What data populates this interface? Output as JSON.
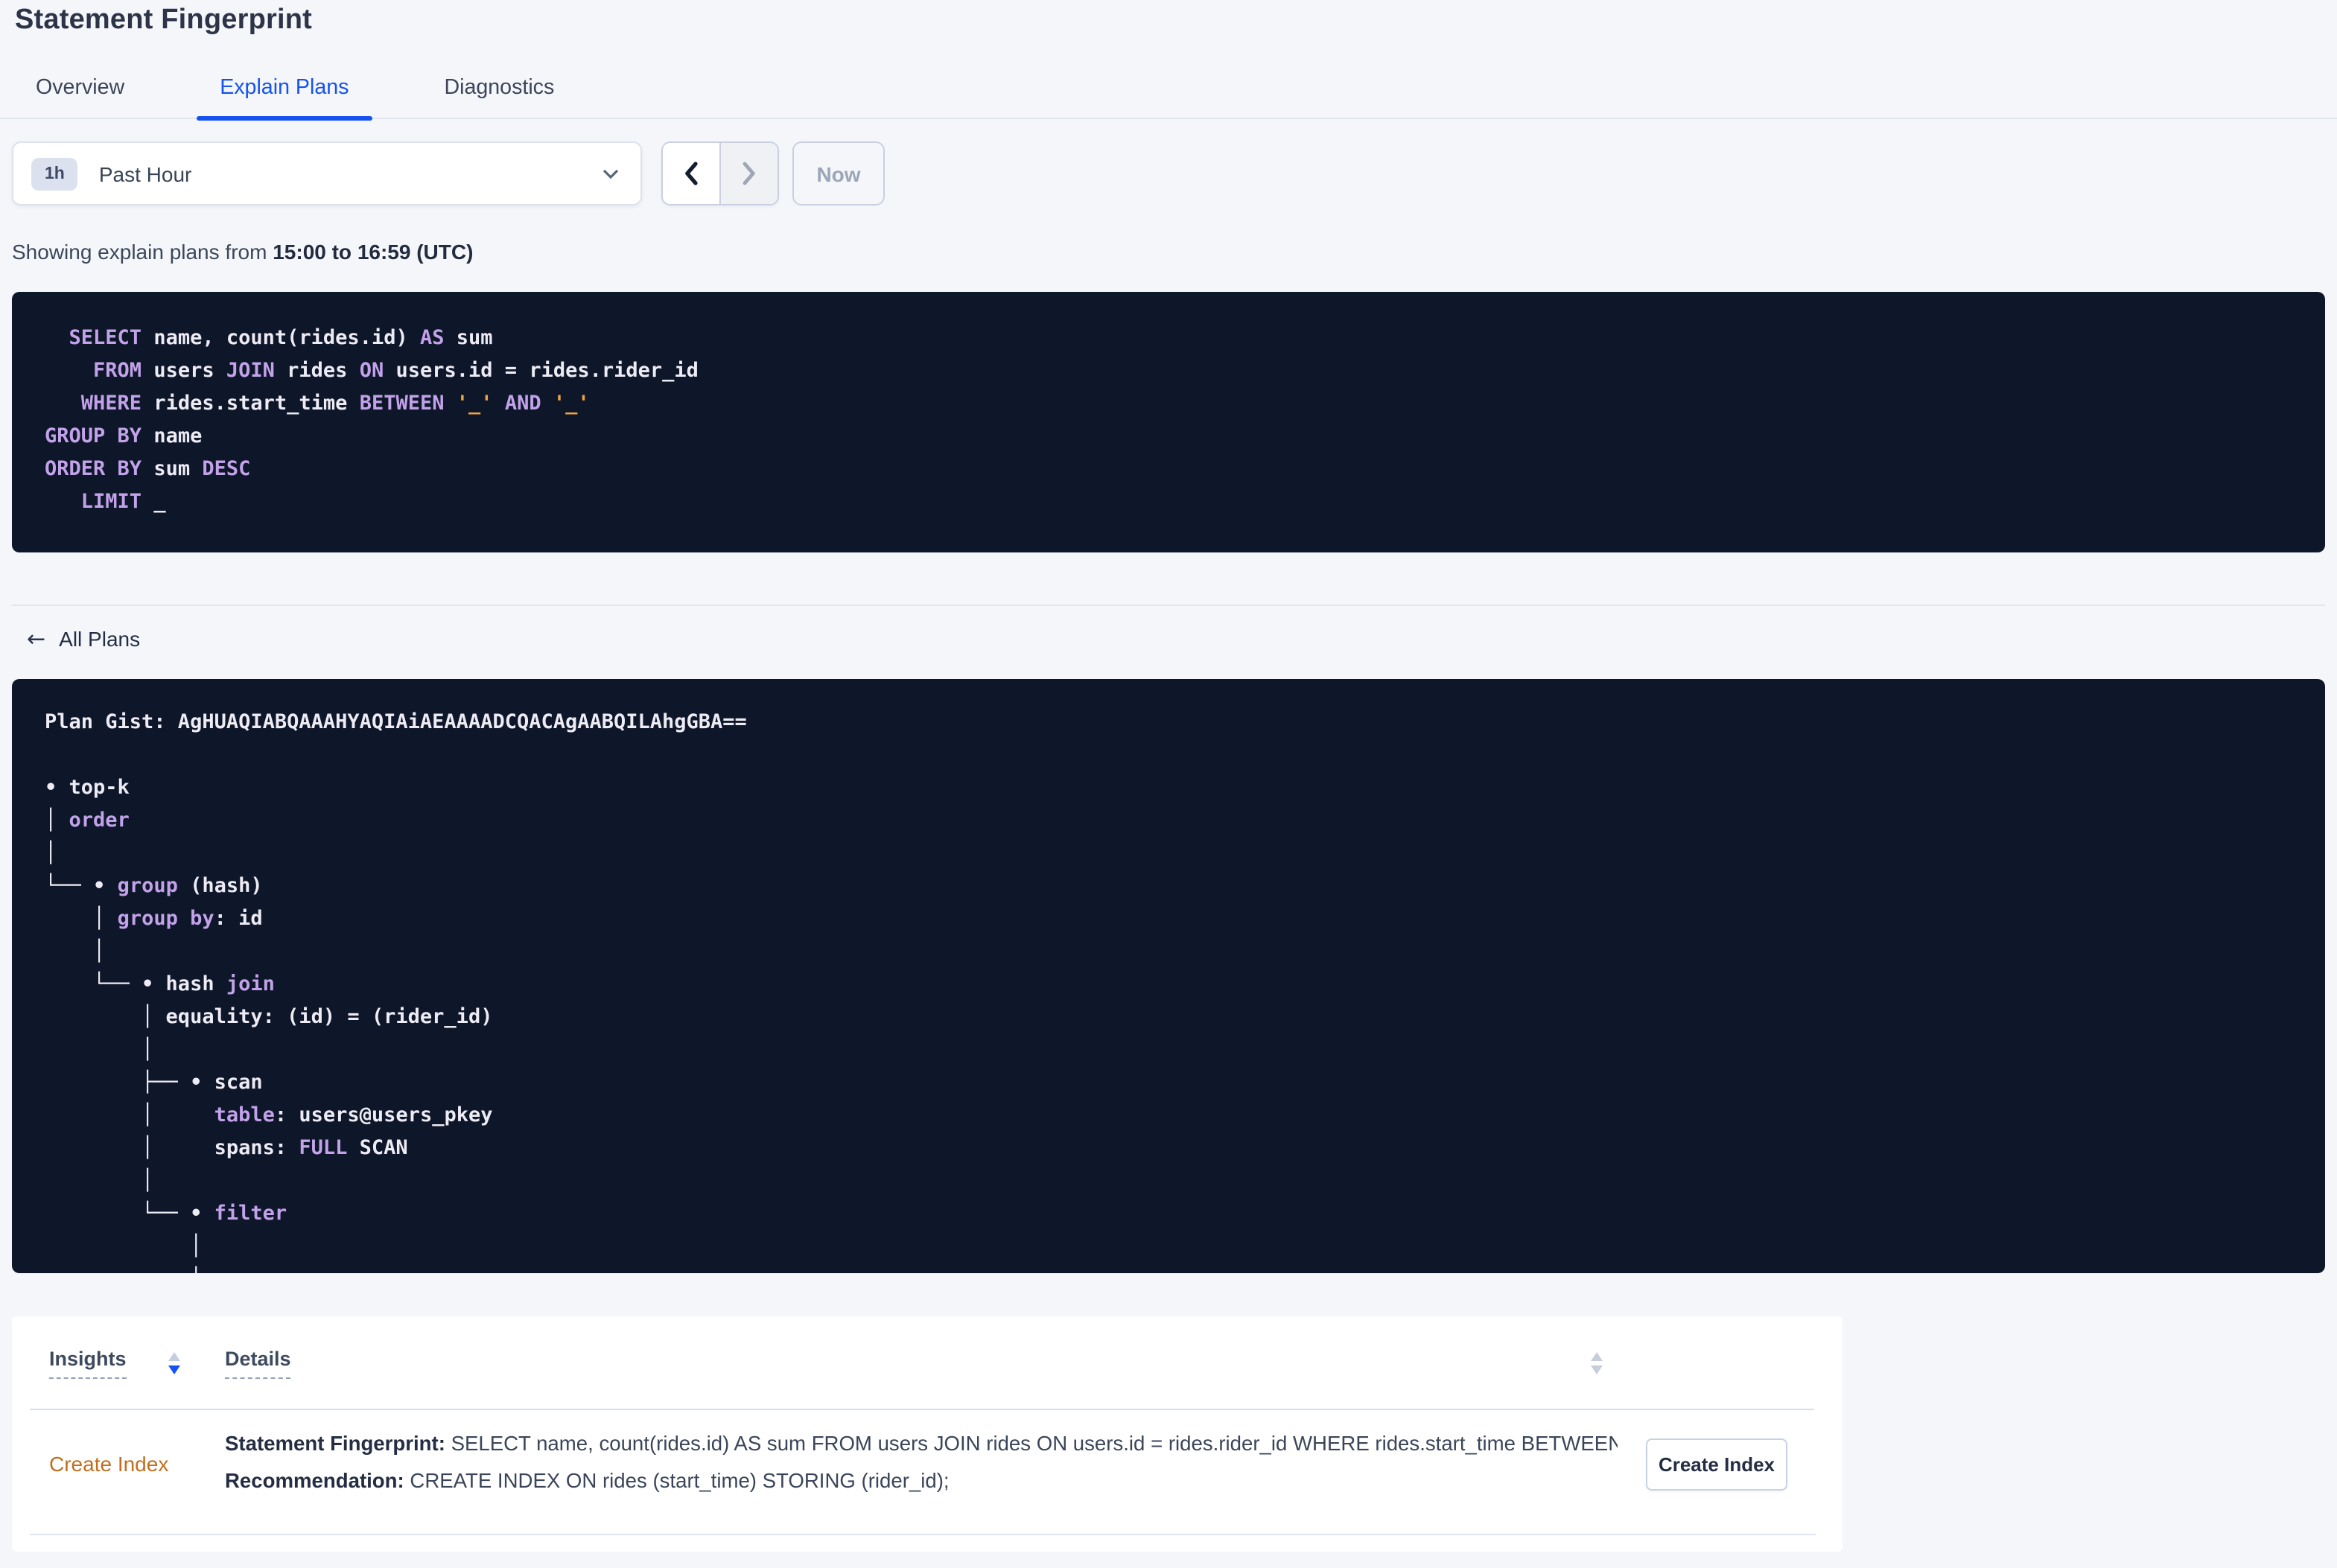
{
  "header": {
    "title": "Statement Fingerprint"
  },
  "tabs": [
    {
      "label": "Overview"
    },
    {
      "label": "Explain Plans"
    },
    {
      "label": "Diagnostics"
    }
  ],
  "active_tab": "Explain Plans",
  "time_picker": {
    "range_badge": "1h",
    "range_label": "Past Hour",
    "now_label": "Now",
    "icons": [
      "chevron-down",
      "chevron-left",
      "chevron-right"
    ]
  },
  "subtitle": {
    "prefix": "Showing explain plans from ",
    "bold_range": "15:00 to 16:59 (UTC)"
  },
  "sql_block": {
    "lines": [
      [
        {
          "t": "  ",
          "c": "id"
        },
        {
          "t": "SELECT",
          "c": "kw"
        },
        {
          "t": " name, count(rides.id) ",
          "c": "id"
        },
        {
          "t": "AS",
          "c": "kw"
        },
        {
          "t": " sum",
          "c": "id"
        }
      ],
      [
        {
          "t": "    ",
          "c": "id"
        },
        {
          "t": "FROM",
          "c": "kw"
        },
        {
          "t": " users ",
          "c": "id"
        },
        {
          "t": "JOIN",
          "c": "kw"
        },
        {
          "t": " rides ",
          "c": "id"
        },
        {
          "t": "ON",
          "c": "kw"
        },
        {
          "t": " users.id = rides.rider_id",
          "c": "id"
        }
      ],
      [
        {
          "t": "   ",
          "c": "id"
        },
        {
          "t": "WHERE",
          "c": "kw"
        },
        {
          "t": " rides.start_time ",
          "c": "id"
        },
        {
          "t": "BETWEEN",
          "c": "kw"
        },
        {
          "t": " ",
          "c": "id"
        },
        {
          "t": "'_'",
          "c": "str"
        },
        {
          "t": " ",
          "c": "id"
        },
        {
          "t": "AND",
          "c": "kw"
        },
        {
          "t": " ",
          "c": "id"
        },
        {
          "t": "'_'",
          "c": "str"
        }
      ],
      [
        {
          "t": "GROUP BY",
          "c": "kw"
        },
        {
          "t": " name",
          "c": "id"
        }
      ],
      [
        {
          "t": "ORDER BY",
          "c": "kw"
        },
        {
          "t": " sum ",
          "c": "id"
        },
        {
          "t": "DESC",
          "c": "kw"
        }
      ],
      [
        {
          "t": "   ",
          "c": "id"
        },
        {
          "t": "LIMIT",
          "c": "kw"
        },
        {
          "t": " _",
          "c": "id"
        }
      ]
    ]
  },
  "plans_nav": {
    "back_arrow": "←",
    "back_label": "All Plans"
  },
  "plan_block": {
    "gist_label": "Plan Gist:",
    "gist": "AgHUAQIABQAAAHYAQIAiAEAAAADCQACAgAABQILAhgGBA==",
    "lines": [
      [
        {
          "t": "Plan Gist: AgHUAQIABQAAAHYAQIAiAEAAAADCQACAgAABQILAhgGBA==",
          "c": "id"
        }
      ],
      [],
      [
        {
          "t": "• top-k",
          "c": "id"
        }
      ],
      [
        {
          "t": "│ ",
          "c": "id"
        },
        {
          "t": "order",
          "c": "kw"
        }
      ],
      [
        {
          "t": "│",
          "c": "id"
        }
      ],
      [
        {
          "t": "└── • ",
          "c": "id"
        },
        {
          "t": "group",
          "c": "kw"
        },
        {
          "t": " (hash)",
          "c": "id"
        }
      ],
      [
        {
          "t": "    │ ",
          "c": "id"
        },
        {
          "t": "group by",
          "c": "kw"
        },
        {
          "t": ": id",
          "c": "id"
        }
      ],
      [
        {
          "t": "    │",
          "c": "id"
        }
      ],
      [
        {
          "t": "    └── • hash ",
          "c": "id"
        },
        {
          "t": "join",
          "c": "kw"
        }
      ],
      [
        {
          "t": "        │ equality: (id) = (rider_id)",
          "c": "id"
        }
      ],
      [
        {
          "t": "        │",
          "c": "id"
        }
      ],
      [
        {
          "t": "        ├── • scan",
          "c": "id"
        }
      ],
      [
        {
          "t": "        │     ",
          "c": "id"
        },
        {
          "t": "table",
          "c": "kw"
        },
        {
          "t": ": users@users_pkey",
          "c": "id"
        }
      ],
      [
        {
          "t": "        │     spans: ",
          "c": "id"
        },
        {
          "t": "FULL",
          "c": "kw"
        },
        {
          "t": " SCAN",
          "c": "id"
        }
      ],
      [
        {
          "t": "        │",
          "c": "id"
        }
      ],
      [
        {
          "t": "        └── • ",
          "c": "id"
        },
        {
          "t": "filter",
          "c": "kw"
        }
      ],
      [
        {
          "t": "            │",
          "c": "id"
        }
      ],
      [
        {
          "t": "            │",
          "c": "id"
        }
      ]
    ]
  },
  "insights_table": {
    "col_insights": "Insights",
    "col_details": "Details",
    "rows": [
      {
        "insight": "Create Index",
        "detail_lines": [
          {
            "label": "Statement Fingerprint:",
            "text": " SELECT name, count(rides.id) AS sum FROM users JOIN rides ON users.id = rides.rider_id WHERE rides.start_time BETWEEN '_..."
          },
          {
            "label": "Recommendation:",
            "text": " CREATE INDEX ON rides (start_time) STORING (rider_id);"
          }
        ],
        "action_label": "Create Index"
      }
    ]
  },
  "colors": {
    "page_bg": "#f4f6fa",
    "accent_blue": "#1652f0",
    "insight_orange": "#c26e1e",
    "code_bg": "#0e1629",
    "code_keyword": "#c2a2e9",
    "code_text": "#edebf4",
    "code_literal": "#f2a43d"
  }
}
